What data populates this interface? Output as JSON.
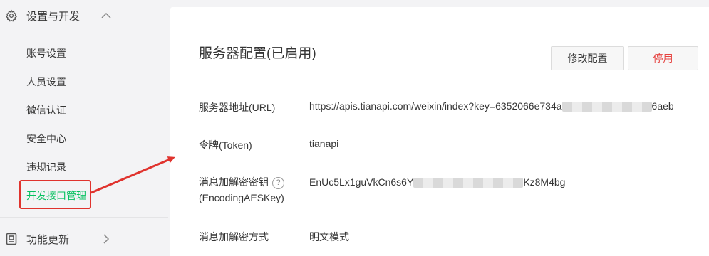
{
  "sidebar": {
    "section1": {
      "label": "设置与开发",
      "icon": "gear-icon",
      "chevron": "chevron-up-icon"
    },
    "items": [
      {
        "label": "账号设置"
      },
      {
        "label": "人员设置"
      },
      {
        "label": "微信认证"
      },
      {
        "label": "安全中心"
      },
      {
        "label": "违规记录"
      },
      {
        "label": "开发接口管理",
        "active": true
      }
    ],
    "section2": {
      "label": "功能更新",
      "icon": "update-icon",
      "chevron": "chevron-right-icon"
    }
  },
  "colors": {
    "accent": "#07c160",
    "annotation": "#e0332e",
    "danger": "#e64340"
  },
  "panel": {
    "title": "服务器配置(已启用)",
    "edit_button": "修改配置",
    "disable_button": "停用",
    "rows": {
      "url": {
        "label": "服务器地址(URL)",
        "value_prefix": "https://apis.tianapi.com/weixin/index?key=6352066e734a",
        "value_suffix": "6aeb"
      },
      "token": {
        "label": "令牌(Token)",
        "value": "tianapi"
      },
      "aes": {
        "label_line1": "消息加解密密钥",
        "label_line2": "(EncodingAESKey)",
        "value_prefix": "EnUc5Lx1guVkCn6s6Y",
        "value_suffix": "Kz8M4bg",
        "help_icon": "question-circle-icon"
      },
      "mode": {
        "label": "消息加解密方式",
        "value": "明文模式"
      }
    }
  }
}
